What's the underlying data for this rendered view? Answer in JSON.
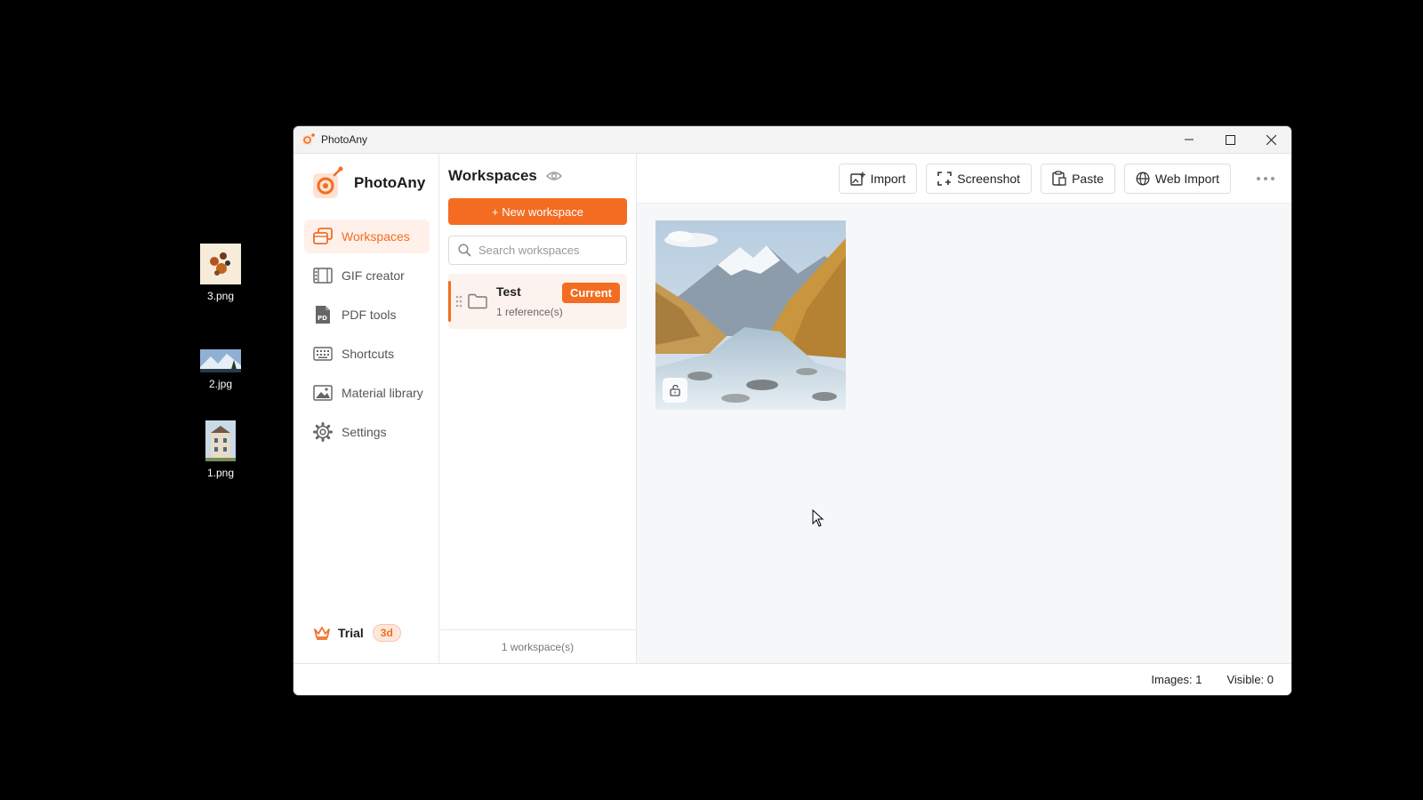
{
  "desktop": {
    "icons": [
      {
        "label": "3.png"
      },
      {
        "label": "2.jpg"
      },
      {
        "label": "1.png"
      }
    ]
  },
  "window": {
    "title": "PhotoAny"
  },
  "sidebar": {
    "brand": "PhotoAny",
    "items": [
      {
        "label": "Workspaces",
        "icon": "workspaces-icon"
      },
      {
        "label": "GIF creator",
        "icon": "gif-icon"
      },
      {
        "label": "PDF tools",
        "icon": "pdf-icon"
      },
      {
        "label": "Shortcuts",
        "icon": "keyboard-icon"
      },
      {
        "label": "Material library",
        "icon": "image-icon"
      },
      {
        "label": "Settings",
        "icon": "gear-icon"
      }
    ],
    "trial_label": "Trial",
    "trial_badge": "3d"
  },
  "workspaces": {
    "title": "Workspaces",
    "new_button": "+ New workspace",
    "search_placeholder": "Search workspaces",
    "items": [
      {
        "name": "Test",
        "sub": "1 reference(s)",
        "badge": "Current"
      }
    ],
    "footer": "1 workspace(s)"
  },
  "toolbar": {
    "import": "Import",
    "screenshot": "Screenshot",
    "paste": "Paste",
    "web_import": "Web Import"
  },
  "status": {
    "images": "Images: 1",
    "visible": "Visible: 0"
  },
  "colors": {
    "accent": "#f36c21",
    "accent_light": "#fff1ea"
  }
}
